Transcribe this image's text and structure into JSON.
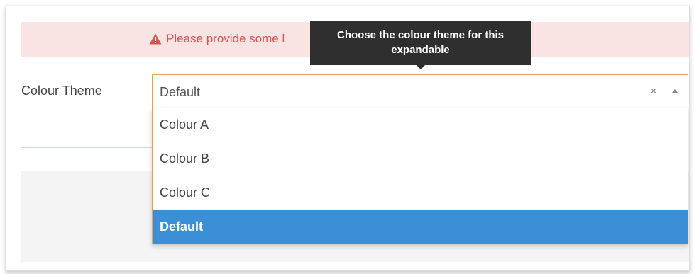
{
  "alert": {
    "message": "Please provide some l",
    "icon": "warning-icon",
    "color": "#d9534f",
    "background": "#f9e3e3"
  },
  "field": {
    "label": "Colour Theme"
  },
  "select": {
    "value": "Default",
    "clear_symbol": "×",
    "accent_color": "#f0a050"
  },
  "dropdown": {
    "options": [
      {
        "label": "Colour A",
        "selected": false
      },
      {
        "label": "Colour B",
        "selected": false
      },
      {
        "label": "Colour C",
        "selected": false
      },
      {
        "label": "Default",
        "selected": true
      }
    ],
    "selected_color": "#3a8fd6"
  },
  "tooltip": {
    "line1": "Choose the colour theme for this",
    "line2": "expandable"
  }
}
